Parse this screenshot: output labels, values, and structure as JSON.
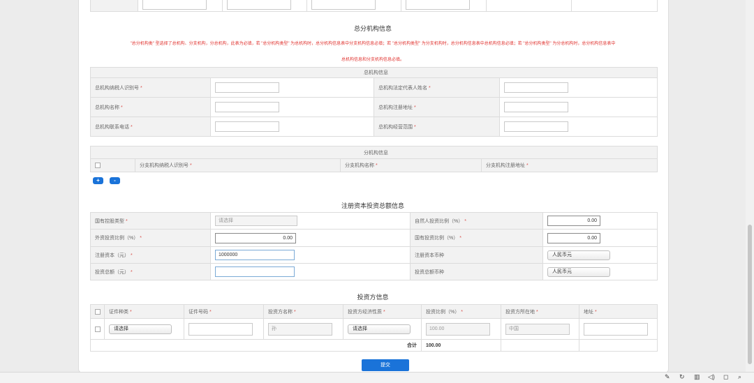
{
  "hq_section": {
    "title": "总分机构信息",
    "warning_line1": "\"总分机构类\" 型选择了总机构、分支机构，分总机构，此表为必填，若 \"总分机构类型\" 为总机构时，总分机构信息表中分支机构信息必填；若 \"总分机构类型\" 为分支机构时，总分机构信息表中总机构信息必填；若 \"总分机构类型\" 为分总机构时，总分机构信息表中",
    "warning_line2": "总机构信息和分支机构信息必填。",
    "hq_table_title": "总机构信息",
    "fields": {
      "taxpayer_id": "总机构纳税人识别号",
      "legal_rep": "总机构法定代表人姓名",
      "name": "总机构名称",
      "address": "总机构注册地址",
      "phone": "总机构联系电话",
      "scope": "总机构经营范围"
    },
    "branch_table_title": "分机构信息",
    "branch_columns": [
      "分支机构纳税人识别号",
      "分支机构名称",
      "分支机构注册地址"
    ],
    "add_label": "+",
    "remove_label": "-"
  },
  "capital_section": {
    "title": "注册资本投资总额信息",
    "state_type_label": "国有控股类型",
    "state_type_placeholder": "请选择",
    "natural_ratio_label": "自然人投资比例（%）",
    "natural_ratio_value": "0.00",
    "foreign_ratio_label": "外资投资比例（%）",
    "foreign_ratio_value": "0.00",
    "state_ratio_label": "国有投资比例（%）",
    "state_ratio_value": "0.00",
    "capital_label": "注册资本（元）",
    "capital_value": "1000000",
    "capital_currency_label": "注册资本币种",
    "capital_currency_value": "人民币元",
    "total_label": "投资总额（元）",
    "total_value": "",
    "total_currency_label": "投资总额币种",
    "total_currency_value": "人民币元"
  },
  "investor_section": {
    "title": "投资方信息",
    "columns": [
      "证件种类",
      "证件号码",
      "投资方名称",
      "投资方经济性质",
      "投资比例（%）",
      "投资方所在地",
      "地址"
    ],
    "row": {
      "id_type": "请选择",
      "id_number": "",
      "name": "孙",
      "nature": "请选择",
      "ratio": "100.00",
      "location": "中国",
      "address": ""
    },
    "total_label": "合计",
    "total_value": "100.00"
  },
  "submit_label": "提交",
  "taskbar_icons": [
    "pen-icon",
    "refresh-icon",
    "trash-icon",
    "speaker-icon",
    "window-icon",
    "search-icon"
  ]
}
